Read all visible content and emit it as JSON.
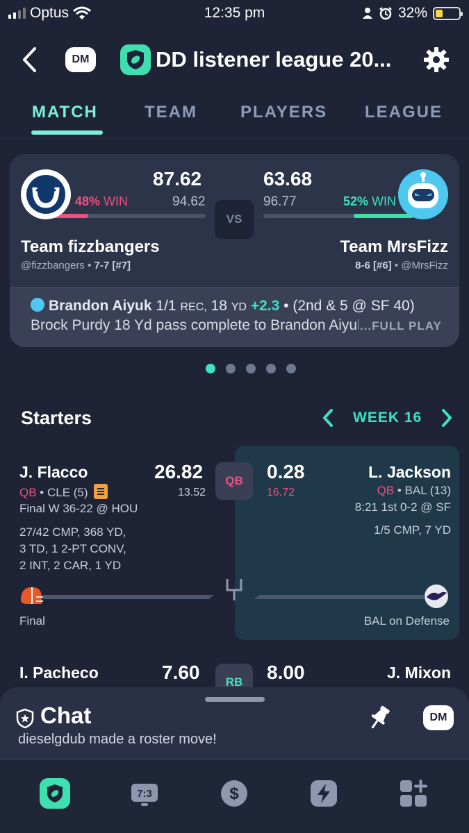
{
  "status_bar": {
    "carrier": "Optus",
    "time": "12:35 pm",
    "battery": "32%",
    "battery_level": 0.32
  },
  "header": {
    "back_icon": "chevron-left-icon",
    "dm_label": "DM",
    "league_title": "DD listener league 20...",
    "settings_icon": "gear-icon"
  },
  "tabs": [
    {
      "label": "MATCH",
      "active": true
    },
    {
      "label": "TEAM",
      "active": false
    },
    {
      "label": "PLAYERS",
      "active": false
    },
    {
      "label": "LEAGUE",
      "active": false
    }
  ],
  "matchup": {
    "home": {
      "score": "87.62",
      "projected": "94.62",
      "win_pct": "48%",
      "win_label": "WIN",
      "win_fraction": 0.48,
      "name": "Team fizzbangers",
      "handle": "@fizzbangers",
      "record": "7-7 [#7]",
      "color": "#f0507e"
    },
    "away": {
      "score": "63.68",
      "projected": "96.77",
      "win_pct": "52%",
      "win_label": "WIN",
      "win_fraction": 0.52,
      "name": "Team MrsFizz",
      "handle": "@MrsFizz",
      "record": "8-6 [#6]",
      "color": "#3ee0a8"
    },
    "vs_label": "VS"
  },
  "latest_play": {
    "player": "Brandon Aiyuk",
    "stat": "1/1",
    "rec_unit": "REC,",
    "yds": "18",
    "yd_unit": "YD",
    "points": "+2.3",
    "situation": "• (2nd & 5 @ SF 40)",
    "description": "Brock Purdy 18 Yd pass complete to Brandon Aiyuk",
    "full_play_label": "...FULL PLAY"
  },
  "pager": {
    "count": 5,
    "active_index": 0
  },
  "starters": {
    "title": "Starters",
    "week_label": "WEEK 16",
    "rows": [
      {
        "position": "QB",
        "left": {
          "name": "J. Flacco",
          "pos": "QB",
          "team": "• CLE (5)",
          "score": "26.82",
          "projected": "13.52",
          "game": "Final W 36-22 @ HOU",
          "stat_lines": [
            "27/42 CMP, 368 YD,",
            "3 TD, 1 2-PT CONV,",
            "2 INT, 2 CAR, 1 YD"
          ],
          "footer": "Final"
        },
        "right": {
          "name": "L. Jackson",
          "pos": "QB",
          "team": "• BAL (13)",
          "score": "0.28",
          "projected": "16.72",
          "game": "8:21 1st 0-2 @ SF",
          "stat_lines": [
            "1/5 CMP, 7 YD"
          ],
          "footer": "BAL on Defense"
        }
      },
      {
        "position": "RB",
        "left": {
          "name": "I. Pacheco",
          "score": "7.60"
        },
        "right": {
          "name": "J. Mixon",
          "score": "8.00"
        }
      }
    ]
  },
  "chat": {
    "title": "Chat",
    "message": "dieselgdub made a roster move!",
    "dm_label": "DM"
  },
  "bottom_nav": [
    {
      "icon": "football-shield-icon",
      "active": true
    },
    {
      "icon": "scoreboard-icon",
      "label": "7:3",
      "active": false
    },
    {
      "icon": "dollar-icon",
      "active": false
    },
    {
      "icon": "lightning-icon",
      "active": false
    },
    {
      "icon": "grid-plus-icon",
      "active": false
    }
  ]
}
